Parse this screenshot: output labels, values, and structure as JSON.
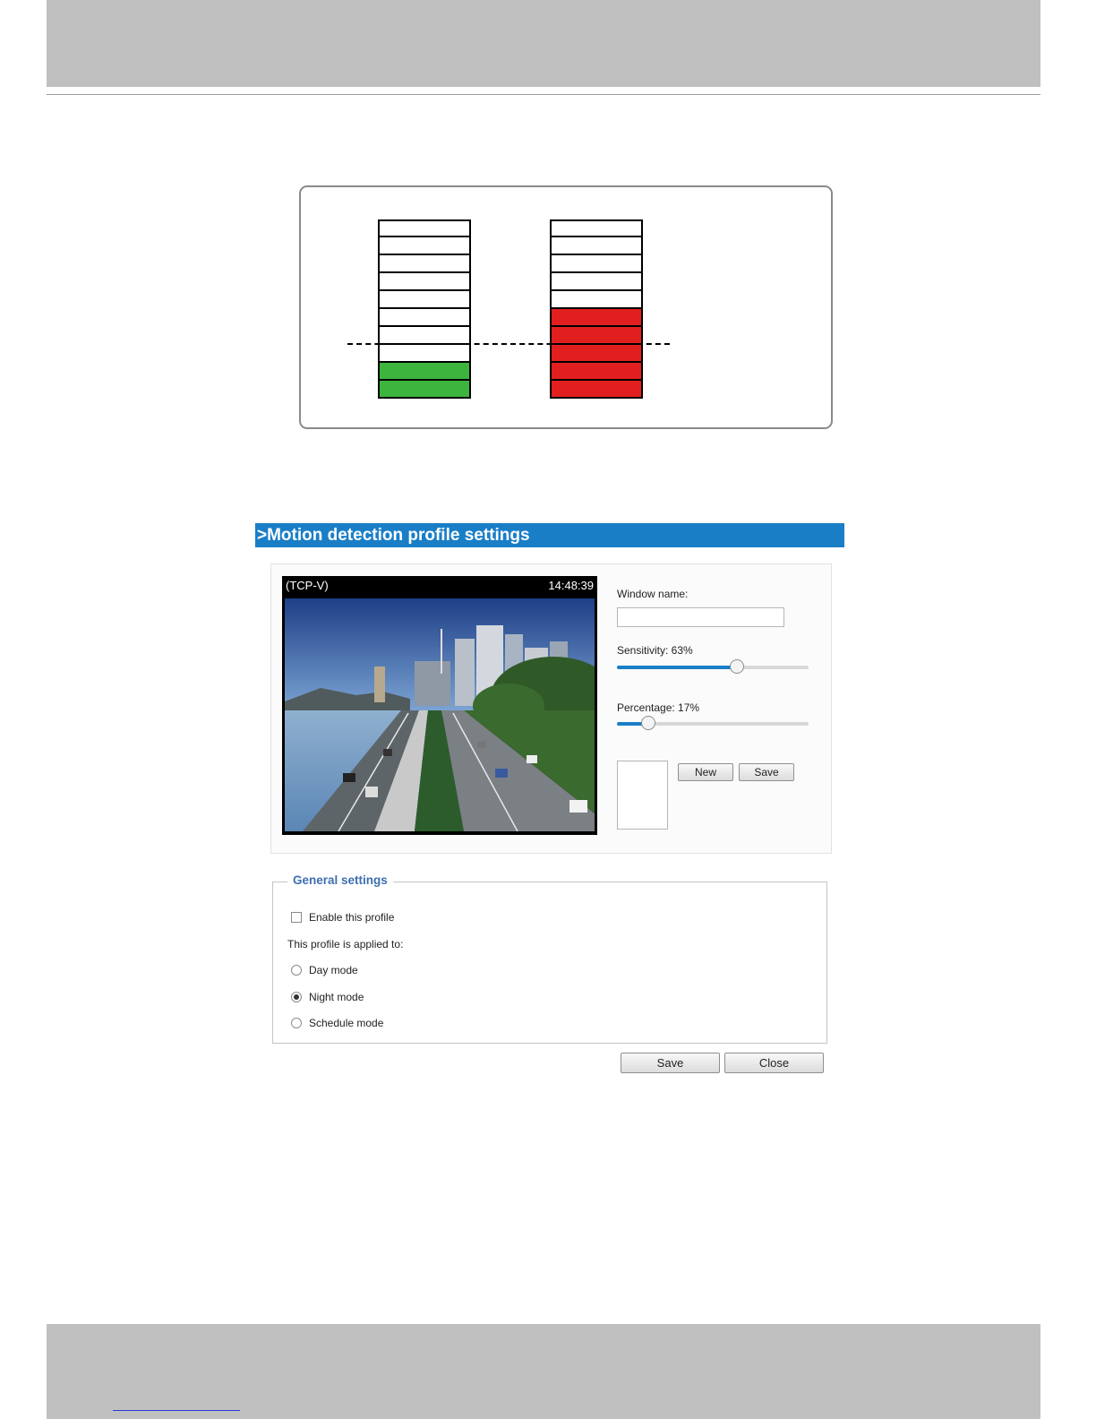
{
  "diagram": {
    "meters": [
      {
        "cells": 10,
        "filled": 2,
        "fill_color": "#3db43d"
      },
      {
        "cells": 10,
        "filled": 5,
        "fill_color": "#e21f1f"
      }
    ]
  },
  "panel": {
    "title": ">Motion detection profile settings",
    "video": {
      "source_label": "(TCP-V)",
      "time": "14:48:39"
    },
    "window_name": {
      "label": "Window name:",
      "value": ""
    },
    "sensitivity": {
      "label": "Sensitivity: 63%",
      "value_pct": 63
    },
    "percentage": {
      "label": "Percentage: 17%",
      "value_pct": 17
    },
    "buttons": {
      "new": "New",
      "save": "Save"
    }
  },
  "general": {
    "legend": "General settings",
    "enable_label": "Enable this profile",
    "enable_checked": false,
    "applied_to_label": "This profile is applied to:",
    "modes": [
      {
        "label": "Day mode",
        "selected": false
      },
      {
        "label": "Night mode",
        "selected": true
      },
      {
        "label": "Schedule mode",
        "selected": false
      }
    ]
  },
  "footer_buttons": {
    "save": "Save",
    "close": "Close"
  },
  "colors": {
    "header_blue": "#1a7ec7",
    "legend_blue": "#3d6fb0"
  }
}
